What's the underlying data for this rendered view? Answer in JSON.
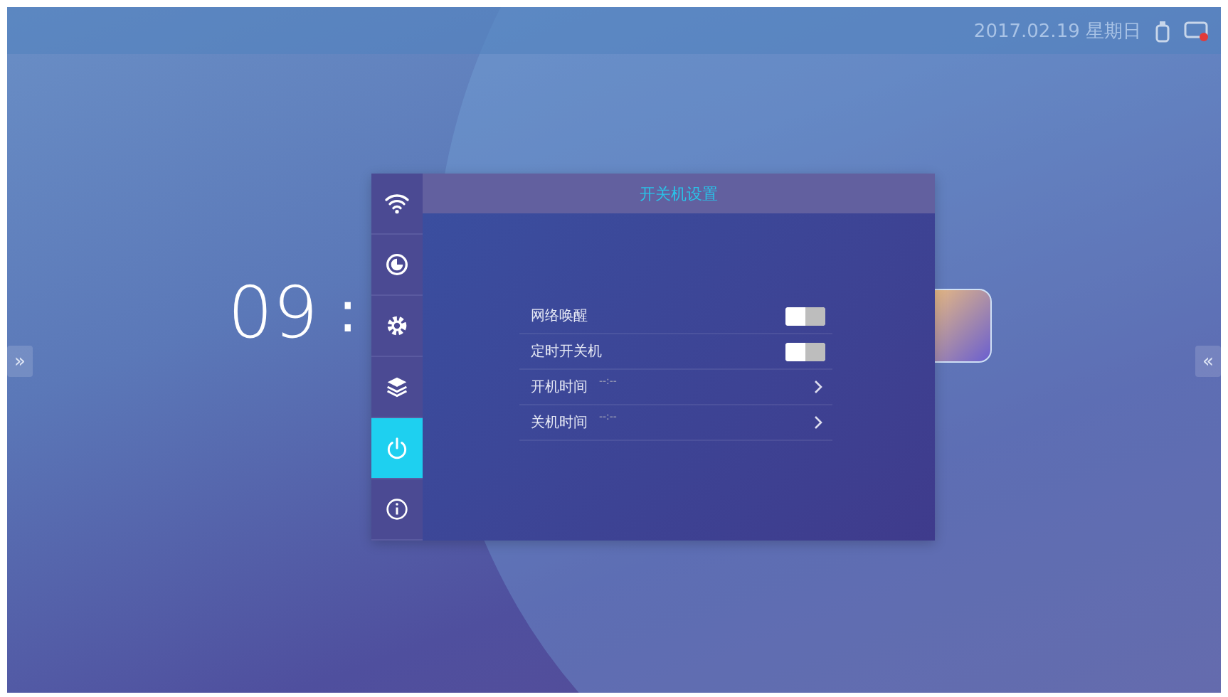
{
  "status_bar": {
    "date": "2017.02.19 星期日"
  },
  "clock": {
    "hours": "09",
    "separator": ":"
  },
  "side_handles": {
    "left": "»",
    "right": "«"
  },
  "dialog": {
    "title": "开关机设置",
    "sidebar": [
      {
        "kind": "wifi",
        "selected": false
      },
      {
        "kind": "clock",
        "selected": false
      },
      {
        "kind": "gear",
        "selected": false
      },
      {
        "kind": "layers",
        "selected": false
      },
      {
        "kind": "power",
        "selected": true
      },
      {
        "kind": "info",
        "selected": false
      }
    ],
    "rows": [
      {
        "kind": "toggle",
        "label": "网络唤醒",
        "on": false
      },
      {
        "kind": "toggle",
        "label": "定时开关机",
        "on": false
      },
      {
        "kind": "link",
        "label": "开机时间",
        "value": "--:--"
      },
      {
        "kind": "link",
        "label": "关机时间",
        "value": "--:--"
      }
    ]
  }
}
